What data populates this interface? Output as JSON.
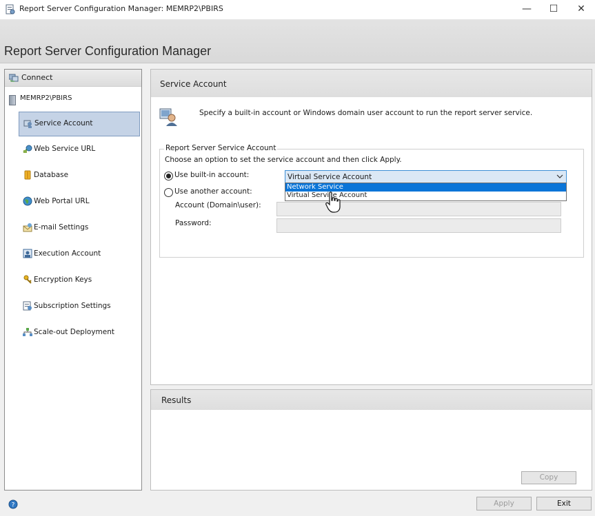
{
  "window": {
    "title": "Report Server Configuration Manager: MEMRP2\\PBIRS",
    "controls": {
      "minimize": "—",
      "maximize": "☐",
      "close": "✕"
    }
  },
  "header": {
    "title": "Report Server Configuration Manager"
  },
  "sidebar": {
    "connect_label": "Connect",
    "server": "MEMRP2\\PBIRS",
    "items": [
      {
        "label": "Service Account",
        "icon": "service-account-icon",
        "selected": true
      },
      {
        "label": "Web Service URL",
        "icon": "web-service-url-icon"
      },
      {
        "label": "Database",
        "icon": "database-icon"
      },
      {
        "label": "Web Portal URL",
        "icon": "globe-icon"
      },
      {
        "label": "E-mail Settings",
        "icon": "email-icon"
      },
      {
        "label": "Execution Account",
        "icon": "execution-account-icon"
      },
      {
        "label": "Encryption Keys",
        "icon": "keys-icon"
      },
      {
        "label": "Subscription Settings",
        "icon": "subscription-icon"
      },
      {
        "label": "Scale-out Deployment",
        "icon": "scale-out-icon"
      }
    ]
  },
  "main": {
    "title": "Service Account",
    "description": "Specify a built-in account or Windows domain user account to run the report server service.",
    "group": {
      "legend": "Report Server Service Account",
      "hint": "Choose an option to set the service account and then click Apply.",
      "builtin_label": "Use built-in account:",
      "builtin_checked": true,
      "builtin_value": "Virtual Service Account",
      "builtin_options": [
        "Network Service",
        "Virtual Service Account"
      ],
      "highlighted_option": "Network Service",
      "another_label": "Use another account:",
      "account_label": "Account (Domain\\user):",
      "account_value": "",
      "password_label": "Password:",
      "password_value": ""
    }
  },
  "results": {
    "title": "Results",
    "copy_label": "Copy"
  },
  "footer": {
    "apply_label": "Apply",
    "exit_label": "Exit"
  },
  "colors": {
    "selection": "#0a75d8",
    "nav_selected": "#c5d3e6",
    "combo_border": "#3d8fd6"
  }
}
